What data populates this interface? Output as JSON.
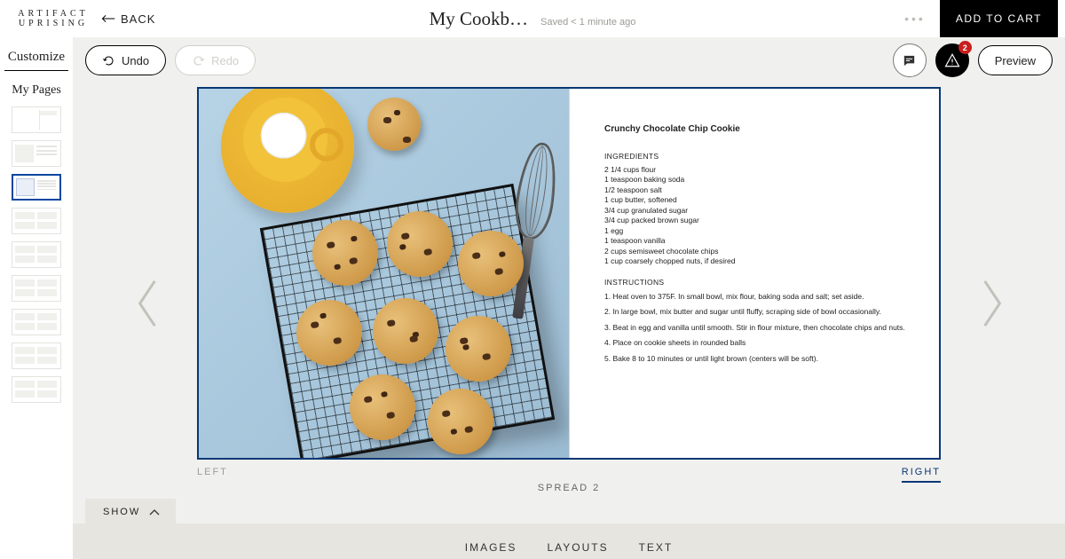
{
  "brand": {
    "line1": "ARTIFACT",
    "line2": "UPRISING"
  },
  "header": {
    "back_label": "BACK",
    "title": "My Cookb…",
    "saved_status": "Saved < 1 minute ago",
    "add_to_cart": "ADD TO CART"
  },
  "toolbar": {
    "undo_label": "Undo",
    "redo_label": "Redo",
    "preview_label": "Preview",
    "alert_count": "2",
    "icons": {
      "chat": "chat-icon",
      "alert": "alert-triangle-icon"
    }
  },
  "sidebar": {
    "tab_label": "Customize",
    "section_label": "My Pages",
    "thumbs": [
      {
        "id": "spread-1",
        "variant": "t0",
        "selected": false
      },
      {
        "id": "spread-2-left",
        "variant": "t1",
        "selected": false
      },
      {
        "id": "spread-2",
        "variant": "t2",
        "selected": true
      },
      {
        "id": "spread-3",
        "variant": "gen",
        "selected": false
      },
      {
        "id": "spread-4",
        "variant": "gen",
        "selected": false
      },
      {
        "id": "spread-5",
        "variant": "gen",
        "selected": false
      },
      {
        "id": "spread-6",
        "variant": "gen",
        "selected": false
      },
      {
        "id": "spread-7",
        "variant": "gen",
        "selected": false
      },
      {
        "id": "spread-8",
        "variant": "gen",
        "selected": false
      }
    ]
  },
  "spread": {
    "left_label": "LEFT",
    "right_label": "RIGHT",
    "spread_label": "SPREAD 2",
    "active_page": "right"
  },
  "recipe": {
    "title": "Crunchy Chocolate Chip Cookie",
    "ingredients_heading": "INGREDIENTS",
    "ingredients": [
      "2 1/4 cups flour",
      "1 teaspoon baking soda",
      "1/2 teaspoon salt",
      "1 cup butter, softened",
      "3/4 cup granulated sugar",
      "3/4 cup packed brown sugar",
      "1 egg",
      "1 teaspoon vanilla",
      "2 cups semisweet chocolate chips",
      "1 cup coarsely chopped nuts, if desired"
    ],
    "instructions_heading": "INSTRUCTIONS",
    "instructions": [
      "1. Heat oven to 375F. In small bowl, mix flour, baking soda and salt; set aside.",
      "2. In large bowl, mix butter and sugar until fluffy, scraping side of bowl occasionally.",
      "3. Beat in egg and vanilla until smooth. Stir in flour mixture, then chocolate chips and nuts.",
      "4. Place on cookie sheets in rounded balls",
      "5. Bake 8 to 10 minutes or until light brown (centers will be soft)."
    ]
  },
  "tray": {
    "show_label": "SHOW",
    "tabs": [
      "IMAGES",
      "LAYOUTS",
      "TEXT"
    ]
  },
  "colors": {
    "brand_blue": "#0a3875",
    "alert_red": "#c81e1e",
    "tray_bg": "#e6e5df",
    "canvas_bg": "#f0f0ee"
  }
}
